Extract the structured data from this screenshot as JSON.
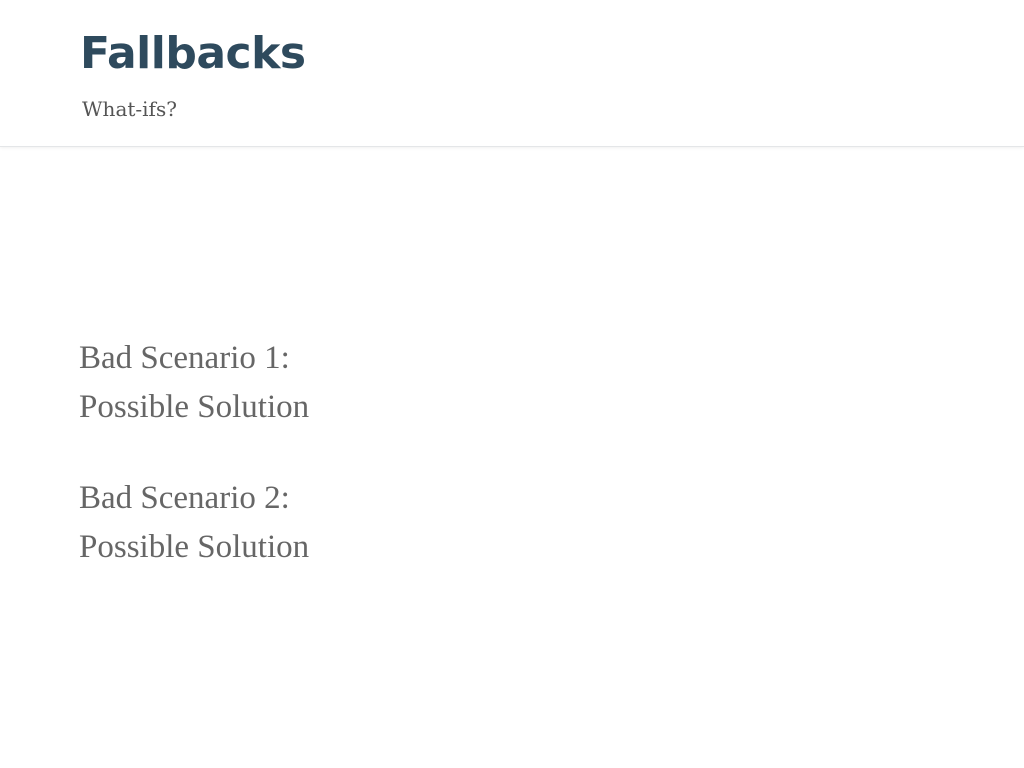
{
  "colors": {
    "title": "#2e4a5d",
    "subtitle": "#555555",
    "body_text": "#666666",
    "background": "#ffffff",
    "header_border": "#e4e6e8"
  },
  "header": {
    "title": "Fallbacks",
    "subtitle": "What-ifs?"
  },
  "scenarios": [
    {
      "problem": "Bad Scenario 1:",
      "solution": "Possible Solution"
    },
    {
      "problem": "Bad Scenario 2:",
      "solution": "Possible Solution"
    }
  ]
}
